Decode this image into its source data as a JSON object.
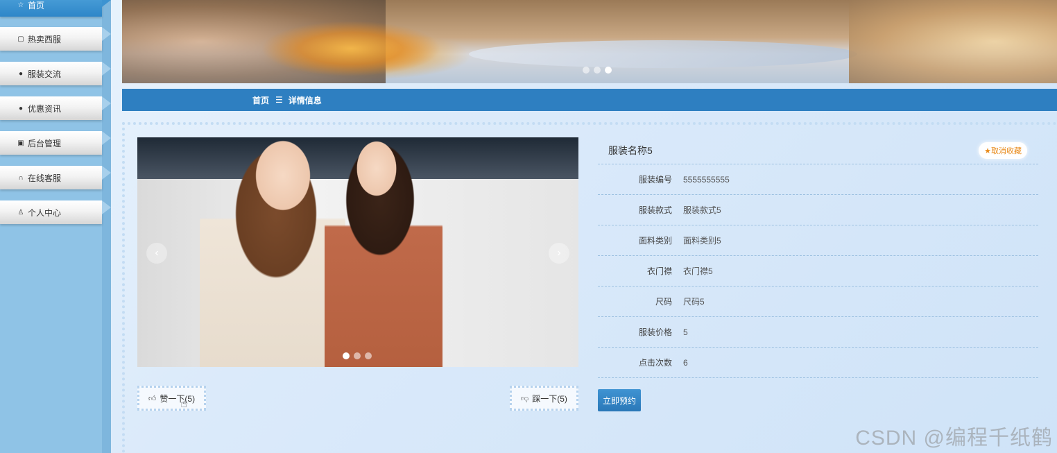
{
  "sidebar": {
    "items": [
      {
        "label": "首页",
        "icon": "star-icon"
      },
      {
        "label": "热卖西服",
        "icon": "bag-icon"
      },
      {
        "label": "服装交流",
        "icon": "info-icon"
      },
      {
        "label": "优惠资讯",
        "icon": "question-icon"
      },
      {
        "label": "后台管理",
        "icon": "briefcase-icon"
      },
      {
        "label": "在线客服",
        "icon": "headset-icon"
      },
      {
        "label": "个人中心",
        "icon": "user-icon"
      }
    ]
  },
  "breadcrumb": {
    "home": "首页",
    "separator": "☰",
    "current": "详情信息"
  },
  "product": {
    "name": "服装名称5",
    "favorite_label": "取消收藏",
    "fields": [
      {
        "key": "服装编号",
        "value": "5555555555"
      },
      {
        "key": "服装款式",
        "value": "服装款式5"
      },
      {
        "key": "面料类别",
        "value": "面料类别5"
      },
      {
        "key": "衣门襟",
        "value": "衣门襟5"
      },
      {
        "key": "尺码",
        "value": "尺码5"
      },
      {
        "key": "服装价格",
        "value": "5"
      },
      {
        "key": "点击次数",
        "value": "6"
      }
    ],
    "book_label": "立即预约"
  },
  "votes": {
    "like": "赞一下(5)",
    "dislike": "踩一下(5)"
  },
  "watermark": "CSDN @编程千纸鹤",
  "colors": {
    "accent": "#2e7fc1",
    "sidebar": "#8fc3e6",
    "favorite": "#e88a1a"
  }
}
